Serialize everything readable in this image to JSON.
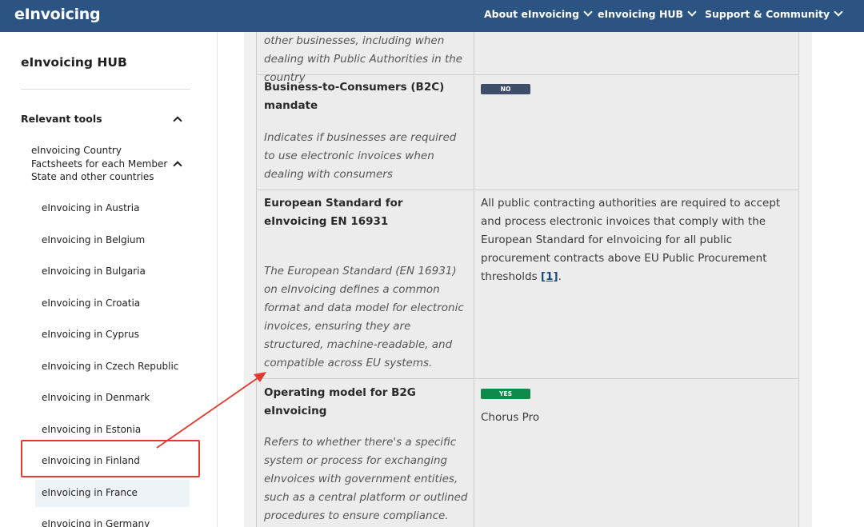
{
  "header": {
    "brand": "eInvoicing",
    "nav": [
      {
        "label": "About eInvoicing"
      },
      {
        "label": "eInvoicing HUB"
      },
      {
        "label": "Support & Community"
      }
    ]
  },
  "sidebar": {
    "title": "eInvoicing HUB",
    "section": "Relevant tools",
    "subsection": "eInvoicing Country Factsheets for each Member State and other countries",
    "items": [
      {
        "label": "eInvoicing in Austria"
      },
      {
        "label": "eInvoicing in Belgium"
      },
      {
        "label": "eInvoicing in Bulgaria"
      },
      {
        "label": "eInvoicing in Croatia"
      },
      {
        "label": "eInvoicing in Cyprus"
      },
      {
        "label": "eInvoicing in Czech Republic"
      },
      {
        "label": "eInvoicing in Denmark"
      },
      {
        "label": "eInvoicing in Estonia"
      },
      {
        "label": "eInvoicing in Finland"
      },
      {
        "label": "eInvoicing in France"
      },
      {
        "label": "eInvoicing in Germany"
      }
    ]
  },
  "table": {
    "rows": [
      {
        "title": "",
        "description": "other businesses, including when dealing with Public Authorities in the country",
        "badge": "",
        "value": ""
      },
      {
        "title": "Business-to-Consumers (B2C) mandate",
        "description": "Indicates if businesses are required to use electronic invoices when dealing with consumers",
        "badge": "NO",
        "value": ""
      },
      {
        "title": "European Standard for eInvoicing EN 16931",
        "description": "The European Standard (EN 16931) on eInvoicing defines a common format and data model for electronic invoices, ensuring they are structured, machine-readable, and compatible across EU systems.",
        "badge": "",
        "value": "All public contracting authorities are required to accept and process electronic invoices that comply with the European Standard for eInvoicing for all public procurement contracts above EU Public Procurement thresholds",
        "link": "[1]"
      },
      {
        "title": "Operating model for B2G eInvoicing",
        "description": "Refers to whether there's a specific system or process for exchanging eInvoices with government entities, such as a central platform or outlined procedures to ensure compliance.",
        "badge": "YES",
        "value": "Chorus Pro"
      }
    ]
  },
  "colors": {
    "navbar": "#2b5482",
    "badge_no": "#3e4e6a",
    "badge_yes": "#0e8a4b",
    "annotation": "#e23a30"
  }
}
